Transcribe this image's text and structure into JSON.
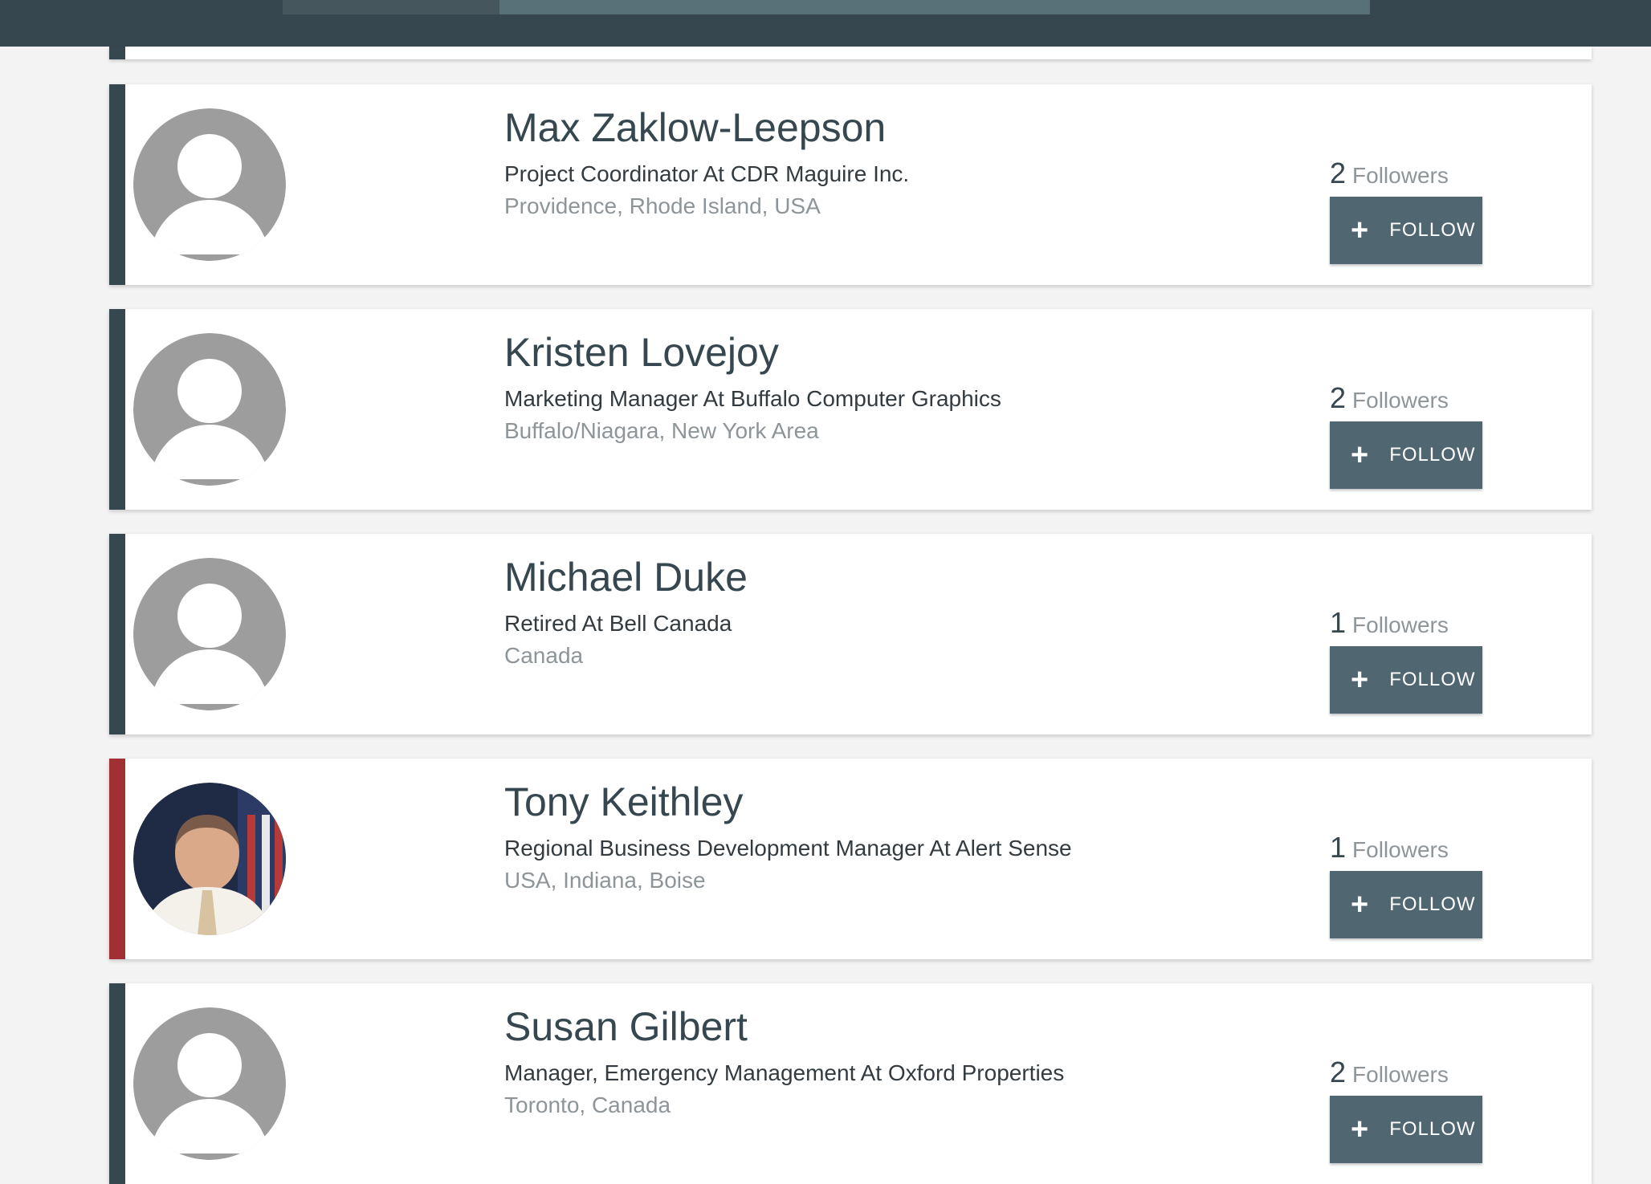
{
  "colors": {
    "header_bg": "#36474f",
    "accent_default": "#36474f",
    "accent_highlight": "#a03033",
    "button_bg": "#506670",
    "page_bg": "#f3f3f3"
  },
  "people": [
    {
      "name": "Max Zaklow-Leepson",
      "title": "Project Coordinator At CDR Maguire Inc.",
      "location": "Providence, Rhode Island, USA",
      "followers_count": "2",
      "followers_label": "Followers",
      "follow_label": "FOLLOW",
      "avatar": "default-avatar-icon",
      "accent": "default"
    },
    {
      "name": "Kristen Lovejoy",
      "title": "Marketing Manager At Buffalo Computer Graphics",
      "location": "Buffalo/Niagara, New York Area",
      "followers_count": "2",
      "followers_label": "Followers",
      "follow_label": "FOLLOW",
      "avatar": "default-avatar-icon",
      "accent": "default"
    },
    {
      "name": "Michael Duke",
      "title": "Retired At Bell Canada",
      "location": "Canada",
      "followers_count": "1",
      "followers_label": "Followers",
      "follow_label": "FOLLOW",
      "avatar": "default-avatar-icon",
      "accent": "default"
    },
    {
      "name": "Tony Keithley",
      "title": "Regional Business Development Manager At Alert Sense",
      "location": "USA, Indiana, Boise",
      "followers_count": "1",
      "followers_label": "Followers",
      "follow_label": "FOLLOW",
      "avatar": "profile-photo",
      "accent": "highlight"
    },
    {
      "name": "Susan Gilbert",
      "title": "Manager, Emergency Management At Oxford Properties",
      "location": "Toronto, Canada",
      "followers_count": "2",
      "followers_label": "Followers",
      "follow_label": "FOLLOW",
      "avatar": "default-avatar-icon",
      "accent": "default"
    }
  ]
}
